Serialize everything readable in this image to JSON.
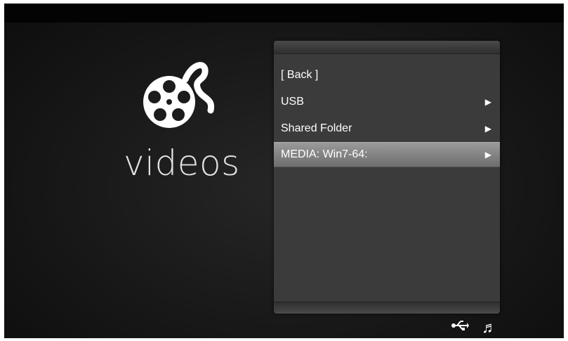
{
  "app": {
    "section_title": "videos",
    "logo_icon": "film-reel-icon"
  },
  "menu": {
    "items": [
      {
        "label": "[ Back ]",
        "has_arrow": false
      },
      {
        "label": "USB",
        "has_arrow": true
      },
      {
        "label": "Shared Folder",
        "has_arrow": true
      },
      {
        "label": "MEDIA: Win7-64:",
        "has_arrow": true,
        "selected": true
      }
    ],
    "arrow_glyph": "▶"
  },
  "status_bar": {
    "icons": [
      "usb-icon",
      "music-note-icon"
    ],
    "usb_glyph": "⭠",
    "music_glyph": "♬"
  },
  "colors": {
    "background": "#181818",
    "panel": "#3b3b3b",
    "selection": "#8a8a8a",
    "text": "#ffffff"
  }
}
